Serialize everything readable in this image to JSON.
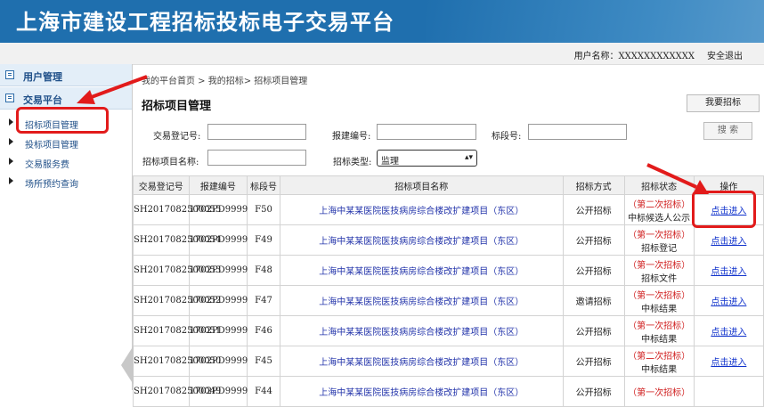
{
  "header": {
    "site_title": "上海市建设工程招标投标电子交易平台",
    "user_label": "用户名称：XXXXXXXXXXXX",
    "logout": "安全退出"
  },
  "sidebar": {
    "sections": [
      {
        "label": "用户管理",
        "icon": "list-icon"
      },
      {
        "label": "交易平台",
        "icon": "list-icon"
      }
    ],
    "items": [
      {
        "label": "招标项目管理"
      },
      {
        "label": "投标项目管理"
      },
      {
        "label": "交易服务费"
      },
      {
        "label": "场所预约查询"
      }
    ]
  },
  "main": {
    "breadcrumb": "我的平台首页 > 我的招标> 招标项目管理",
    "title": "招标项目管理",
    "new_button": "我要招标",
    "search_button": "搜 索",
    "filters": {
      "reg_no_label": "交易登记号:",
      "reg_no_value": "",
      "report_no_label": "报建编号:",
      "report_no_value": "",
      "lot_no_label": "标段号:",
      "lot_no_value": "",
      "project_name_label": "招标项目名称:",
      "project_name_value": "",
      "type_label": "招标类型:",
      "type_value": "监理"
    }
  },
  "table": {
    "headers": [
      "交易登记号",
      "报建编号",
      "标段号",
      "招标项目名称",
      "招标方式",
      "招标状态",
      "操作"
    ],
    "rows": [
      {
        "reg": "SH2017082500055",
        "report": "1702PD9999",
        "lot": "F50",
        "name": "上海中某某医院医技病房综合楼改扩建项目（东区）",
        "method": "公开招标",
        "status_red": "（第二次招标）",
        "status": "中标候选人公示",
        "action": "点击进入"
      },
      {
        "reg": "SH2017082500054",
        "report": "1702PD9999",
        "lot": "F49",
        "name": "上海中某某医院医技病房综合楼改扩建项目（东区）",
        "method": "公开招标",
        "status_red": "（第一次招标）",
        "status": "招标登记",
        "action": "点击进入"
      },
      {
        "reg": "SH2017082500053",
        "report": "1702PD9999",
        "lot": "F48",
        "name": "上海中某某医院医技病房综合楼改扩建项目（东区）",
        "method": "公开招标",
        "status_red": "（第一次招标）",
        "status": "招标文件",
        "action": "点击进入"
      },
      {
        "reg": "SH2017082500052",
        "report": "1702PD9999",
        "lot": "F47",
        "name": "上海中某某医院医技病房综合楼改扩建项目（东区）",
        "method": "邀请招标",
        "status_red": "（第一次招标）",
        "status": "中标结果",
        "action": "点击进入"
      },
      {
        "reg": "SH2017082500051",
        "report": "1702PD9999",
        "lot": "F46",
        "name": "上海中某某医院医技病房综合楼改扩建项目（东区）",
        "method": "公开招标",
        "status_red": "（第一次招标）",
        "status": "中标结果",
        "action": "点击进入"
      },
      {
        "reg": "SH2017082500050",
        "report": "1702PD9999",
        "lot": "F45",
        "name": "上海中某某医院医技病房综合楼改扩建项目（东区）",
        "method": "公开招标",
        "status_red": "（第二次招标）",
        "status": "中标结果",
        "action": "点击进入"
      },
      {
        "reg": "SH2017082500049",
        "report": "1702PD9999",
        "lot": "F44",
        "name": "上海中某某医院医技病房综合楼改扩建项目（东区）",
        "method": "公开招标",
        "status_red": "（第一次招标）",
        "status": "",
        "action": ""
      }
    ]
  },
  "colors": {
    "banner": "#1f6fae",
    "highlight": "#e21b1b",
    "status_red": "#d02020",
    "link": "#1133cc"
  }
}
